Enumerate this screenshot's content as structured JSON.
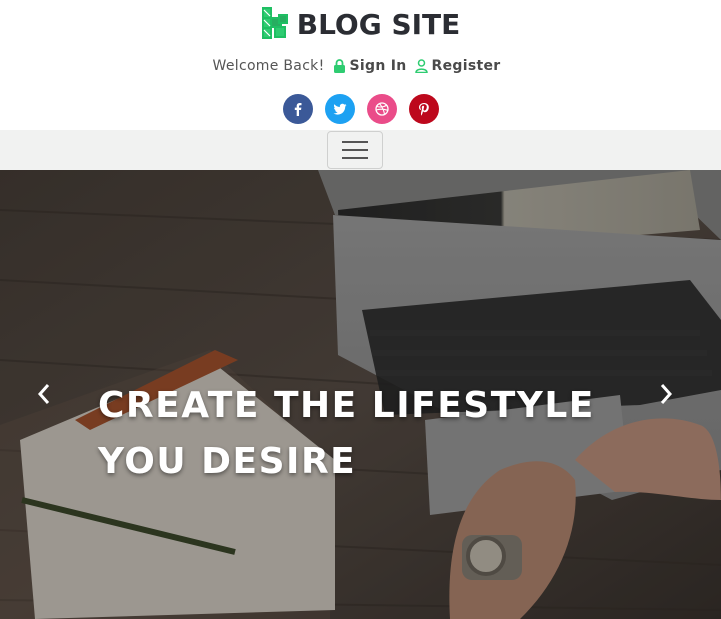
{
  "brand": {
    "name": "BLOG SITE",
    "logo_color": "#2ecc71"
  },
  "welcome": {
    "text": "Welcome Back!",
    "sign_in": "Sign In",
    "register": "Register",
    "accent": "#2ecc71"
  },
  "social": [
    {
      "name": "facebook-icon",
      "color": "#3b5998"
    },
    {
      "name": "twitter-icon",
      "color": "#1da1f2"
    },
    {
      "name": "dribbble-icon",
      "color": "#ea4c89"
    },
    {
      "name": "pinterest-icon",
      "color": "#bd081c"
    }
  ],
  "navbar": {
    "toggler_icon": "hamburger-icon"
  },
  "hero": {
    "headline_line1": "CREATE THE LIFESTYLE",
    "headline_line2": "YOU DESIRE",
    "prev_icon": "chevron-left-icon",
    "next_icon": "chevron-right-icon"
  }
}
